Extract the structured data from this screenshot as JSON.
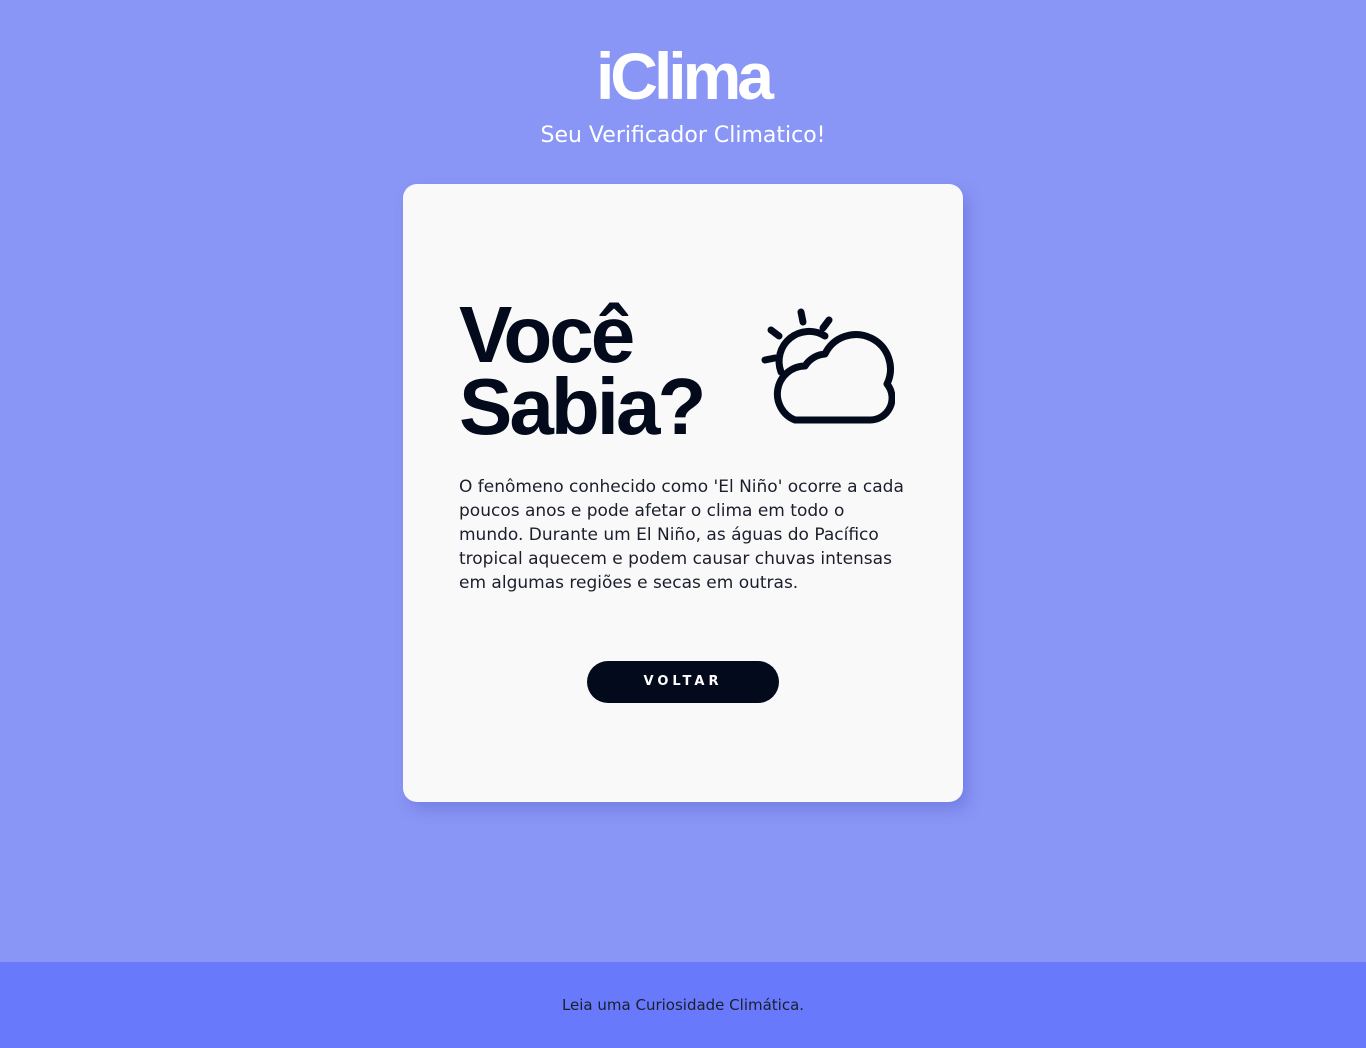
{
  "header": {
    "title": "iClima",
    "subtitle": "Seu Verificador Climatico!"
  },
  "card": {
    "heading": "Você Sabia?",
    "icon": "sun-cloud-icon",
    "text": "O fenômeno conhecido como 'El Niño' ocorre a cada poucos anos e pode afetar o clima em todo o mundo. Durante um El Niño, as águas do Pacífico tropical aquecem e podem causar chuvas intensas em algumas regiões e secas em outras.",
    "button_label": "VOLTAR"
  },
  "footer": {
    "text": "Leia uma Curiosidade Climática."
  },
  "colors": {
    "background": "#8a96f5",
    "footer": "#6879fb",
    "card": "#f9f9f9",
    "dark": "#030a1c"
  }
}
